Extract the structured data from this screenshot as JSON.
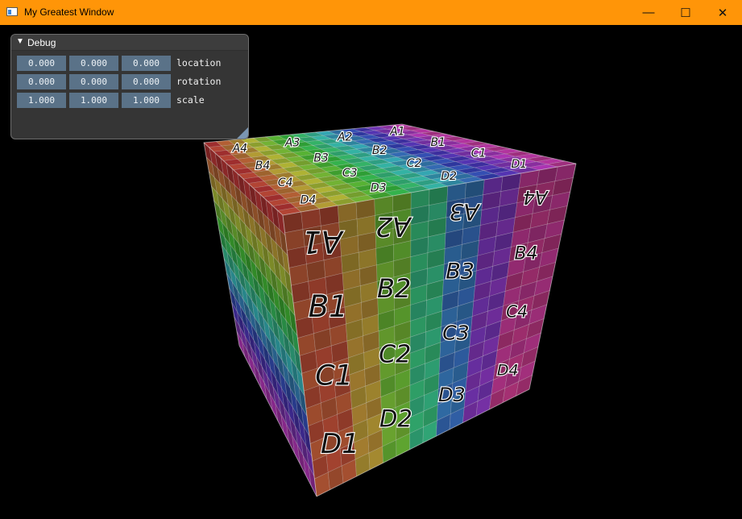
{
  "window": {
    "title": "My Greatest Window",
    "buttons": {
      "minimize": "—",
      "maximize": "☐",
      "close": "✕"
    }
  },
  "colors": {
    "titlebar": "#ff9508",
    "viewport_background": "#000000",
    "field_background": "#5a7288"
  },
  "debug_panel": {
    "title": "Debug",
    "arrow": "▼",
    "rows": [
      {
        "label": "location",
        "values": [
          "0.000",
          "0.000",
          "0.000"
        ]
      },
      {
        "label": "rotation",
        "values": [
          "0.000",
          "0.000",
          "0.000"
        ]
      },
      {
        "label": "scale",
        "values": [
          "1.000",
          "1.000",
          "1.000"
        ]
      }
    ]
  },
  "cube": {
    "front_labels": [
      "A1",
      "A2",
      "A3",
      "A4",
      "B1",
      "B2",
      "B3",
      "B4",
      "C1",
      "C2",
      "C3",
      "C4",
      "D1",
      "D2",
      "D3",
      "D4"
    ],
    "top_labels": [
      "A4",
      "A3",
      "A2",
      "A1",
      "B4",
      "B3",
      "B2",
      "B1",
      "C4",
      "C3",
      "C2",
      "C1",
      "D4",
      "D3",
      "D2",
      "D1"
    ]
  }
}
